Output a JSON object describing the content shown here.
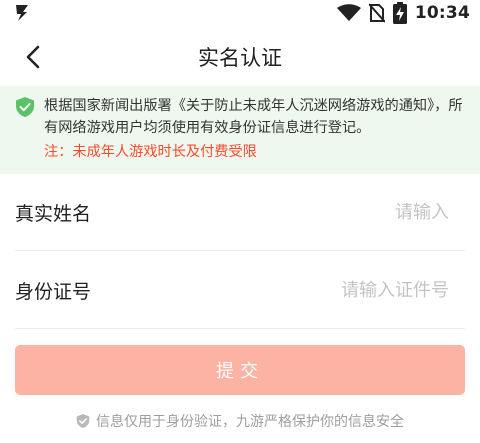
{
  "status_bar": {
    "time": "10:34",
    "icons": [
      "app-bolt-icon",
      "wifi-icon",
      "no-sim-icon",
      "battery-charging-icon"
    ]
  },
  "header": {
    "back_icon": "back-arrow-icon",
    "title": "实名认证"
  },
  "notice": {
    "icon": "shield-check-icon",
    "text": "根据国家新闻出版署《关于防止未成年人沉迷网络游戏的通知》，所有网络游戏用户均须使用有效身份证信息进行登记。",
    "warning": "注：未成年人游戏时长及付费受限",
    "colors": {
      "background": "#eef8ee",
      "icon": "#5bc26a",
      "warning": "#ff4a2e"
    }
  },
  "form": {
    "name": {
      "label": "真实姓名",
      "placeholder": "请输入",
      "value": ""
    },
    "id": {
      "label": "身份证号",
      "placeholder": "请输入证件号",
      "value": ""
    }
  },
  "submit": {
    "label": "提交",
    "color": "#fdb3a3"
  },
  "footer": {
    "icon": "shield-check-icon",
    "text": "信息仅用于身份验证，九游严格保护你的信息安全"
  }
}
